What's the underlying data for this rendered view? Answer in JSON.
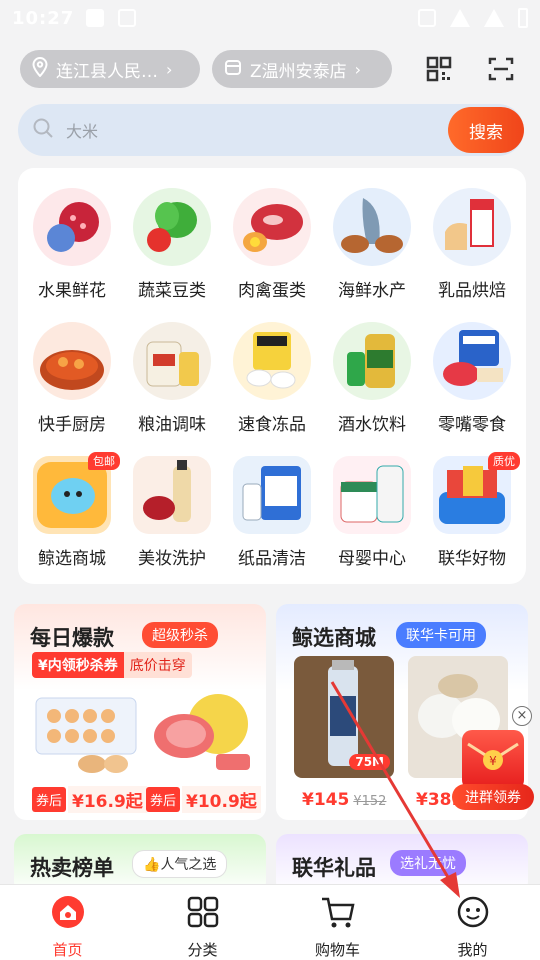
{
  "status_bar": {
    "time": "10:27"
  },
  "location": {
    "address": "连江县人民…",
    "store": "Z温州安泰店"
  },
  "search": {
    "placeholder": "大米",
    "button": "搜索"
  },
  "categories": [
    {
      "label": "水果鲜花",
      "icon": "fruit-flower-icon"
    },
    {
      "label": "蔬菜豆类",
      "icon": "vegetable-icon"
    },
    {
      "label": "肉禽蛋类",
      "icon": "meat-egg-icon"
    },
    {
      "label": "海鲜水产",
      "icon": "seafood-icon"
    },
    {
      "label": "乳品烘焙",
      "icon": "dairy-bakery-icon"
    },
    {
      "label": "快手厨房",
      "icon": "quick-kitchen-icon"
    },
    {
      "label": "粮油调味",
      "icon": "grain-oil-icon"
    },
    {
      "label": "速食冻品",
      "icon": "frozen-food-icon"
    },
    {
      "label": "酒水饮料",
      "icon": "drinks-icon"
    },
    {
      "label": "零嘴零食",
      "icon": "snacks-icon"
    },
    {
      "label": "鲸选商城",
      "icon": "whale-mall-icon",
      "badge": "包邮"
    },
    {
      "label": "美妆洗护",
      "icon": "beauty-icon"
    },
    {
      "label": "纸品清洁",
      "icon": "paper-cleaning-icon"
    },
    {
      "label": "母婴中心",
      "icon": "baby-icon"
    },
    {
      "label": "联华好物",
      "icon": "lianhua-icon",
      "badge": "质优"
    }
  ],
  "promo": {
    "daily": {
      "title": "每日爆款",
      "tag": "超级秒杀",
      "coupon_a": "¥内领秒杀券",
      "coupon_b": "底价击穿",
      "price_label": "券后",
      "price1": "¥16.9起",
      "price2": "¥10.9起"
    },
    "whale": {
      "title": "鲸选商城",
      "tag": "联华卡可用",
      "price1": "¥145",
      "price1_old": "¥152",
      "price2": "¥38.",
      "volume_badge": "75M"
    },
    "hot": {
      "title": "热卖榜单",
      "tag": "人气之选"
    },
    "gift": {
      "title": "联华礼品",
      "tag": "选礼无忧"
    }
  },
  "floating": {
    "button": "进群领券",
    "close": "×"
  },
  "nav": [
    {
      "label": "首页",
      "icon": "home-icon",
      "active": true
    },
    {
      "label": "分类",
      "icon": "category-grid-icon",
      "active": false
    },
    {
      "label": "购物车",
      "icon": "cart-icon",
      "active": false
    },
    {
      "label": "我的",
      "icon": "profile-icon",
      "active": false
    }
  ],
  "colors": {
    "accent": "#ff3b30",
    "search_bg": "#dde7f4",
    "pill_bg": "#c9c9cc"
  }
}
